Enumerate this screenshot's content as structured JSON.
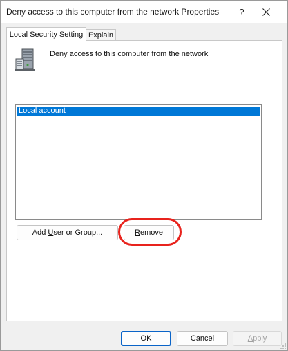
{
  "window": {
    "title": "Deny access to this computer from the network Properties",
    "help_label": "?",
    "close_icon": "close-icon"
  },
  "tabs": [
    {
      "label": "Local Security Setting",
      "active": true
    },
    {
      "label": "Explain",
      "active": false
    }
  ],
  "policy": {
    "icon": "server-tower-icon",
    "title": "Deny access to this computer from the network"
  },
  "list": {
    "items": [
      {
        "label": "Local account",
        "selected": true
      }
    ]
  },
  "buttons": {
    "add_user_prefix": "Add ",
    "add_user_mnemonic": "U",
    "add_user_suffix": "ser or Group...",
    "remove_mnemonic": "R",
    "remove_suffix": "emove",
    "ok": "OK",
    "cancel": "Cancel",
    "apply_mnemonic": "A",
    "apply_suffix": "pply"
  },
  "colors": {
    "selection": "#0078d7",
    "highlight_ring": "#e8231d",
    "default_button_border": "#0a64c8"
  }
}
